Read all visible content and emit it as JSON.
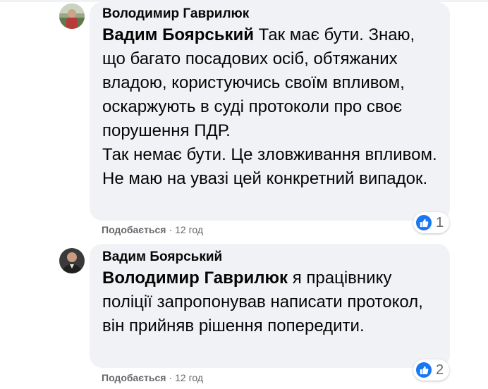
{
  "comments": [
    {
      "author": "Володимир Гаврилюк",
      "mention": "Вадим Боярський",
      "text_1": " Так має бути. Знаю, що багато посадових осіб, обтяжаних владою, користуючись своїм впливом, оскаржують в суді протоколи про своє порушення ПДР.",
      "text_2": "Так немає бути. Це зловживання впливом. Не маю на увазі цей конкретний випадок.",
      "like_label": "Подобається",
      "separator": "·",
      "time": "12 год",
      "reaction_icon": "like-icon",
      "reaction_count": "1"
    },
    {
      "author": "Вадим Боярський",
      "mention": "Володимир Гаврилюк",
      "text_1": " я працівнику поліції запропонував написати протокол, він прийняв рішення попередити.",
      "like_label": "Подобається",
      "separator": "·",
      "time": "12 год",
      "reaction_icon": "like-icon",
      "reaction_count": "2"
    }
  ],
  "colors": {
    "bubble": "#f0f2f5",
    "meta_text": "#65676b",
    "like_blue": "#1877f2"
  }
}
